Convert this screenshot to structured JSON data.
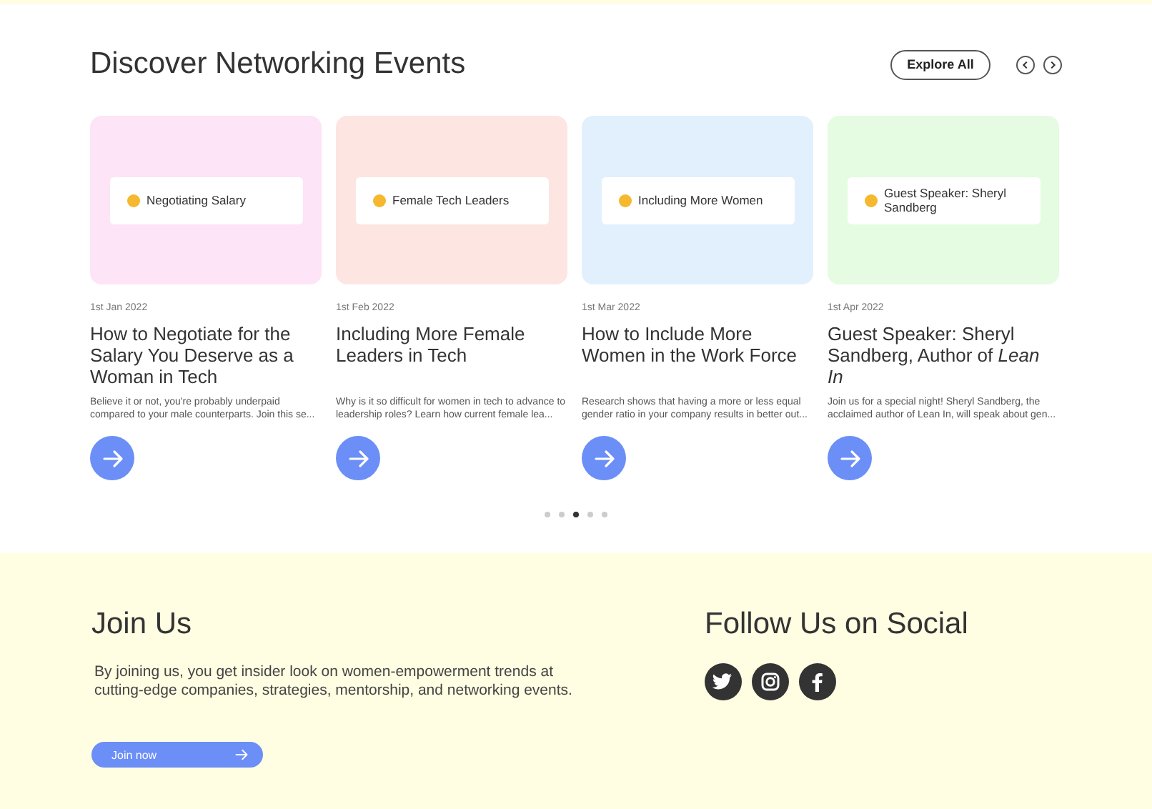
{
  "events": {
    "title": "Discover Networking Events",
    "explore_button": "Explore All",
    "cards": [
      {
        "color": "#fde4f6",
        "tag": "Negotiating Salary",
        "date": "1st Jan 2022",
        "title": "How to Negotiate for the Salary You Deserve as a Woman in Tech",
        "summary": "Believe it or not, you're probably underpaid compared to your male counterparts. Join this se..."
      },
      {
        "color": "#fde5e2",
        "tag": "Female Tech Leaders",
        "date": "1st Feb 2022",
        "title": "Including More Female Leaders in Tech",
        "summary": "Why is it so difficult for women in tech to advance to leadership roles? Learn how current female lea..."
      },
      {
        "color": "#e2f0fd",
        "tag": "Including More Women",
        "date": "1st Mar 2022",
        "title": "How to Include More Women in the Work Force",
        "summary": "Research shows that having a more or less equal gender ratio in your company results in better out..."
      },
      {
        "color": "#e5fce2",
        "tag": "Guest Speaker: Sheryl Sandberg",
        "date": "1st Apr 2022",
        "title": "Guest Speaker: Sheryl Sandberg, Author of *Lean In*",
        "summary": "Join us for a special night! Sheryl Sandberg, the acclaimed author of Lean In, will speak about gen..."
      }
    ],
    "pager": [
      {
        "selected": false
      },
      {
        "selected": false
      },
      {
        "selected": true
      },
      {
        "selected": false
      },
      {
        "selected": false
      }
    ]
  },
  "join": {
    "title": "Join Us",
    "text": "By joining us, you get insider look on women-empowerment trends at cutting-edge companies, strategies, mentorship, and networking events.",
    "button": "Join now"
  },
  "social": {
    "title": "Follow Us on Social",
    "links": [
      {
        "kind": "twitter"
      },
      {
        "kind": "instagram"
      },
      {
        "kind": "facebook"
      }
    ]
  }
}
